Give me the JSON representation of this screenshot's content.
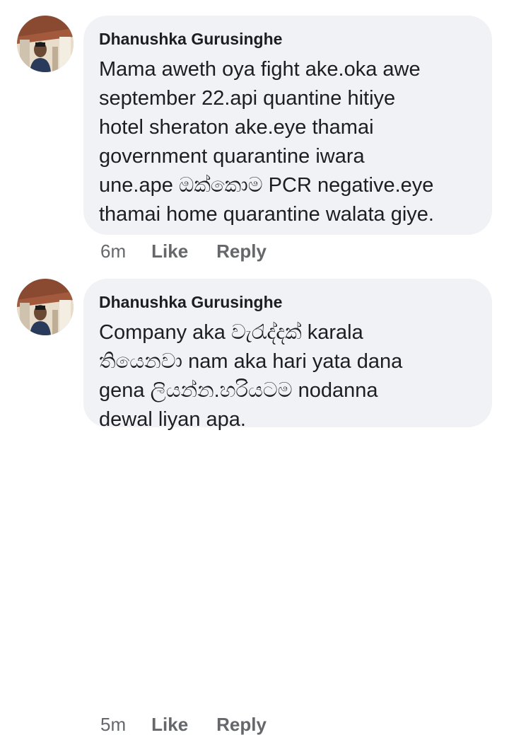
{
  "comments": [
    {
      "author": "Dhanushka Gurusinghe",
      "text": "Mama aweth oya fight ake.oka awe\nseptember 22.api quantine hitiye\nhotel sheraton ake.eye thamai\ngovernment quarantine iwara\nune.ape ඔක්කොම PCR negative.eye\nthamai home quarantine walata giye.",
      "time": "6m",
      "like_label": "Like",
      "reply_label": "Reply"
    },
    {
      "author": "Dhanushka Gurusinghe",
      "text": "Company aka වැරැද්දක් karala\nතියෙනවා nam aka hari yata dana\ngena ලියන්න.හරියටම nodanna\ndewal liyan apa.",
      "time": "5m",
      "like_label": "Like",
      "reply_label": "Reply"
    }
  ],
  "colors": {
    "bubble_bg": "#f0f2f5",
    "text": "#1c1e21",
    "meta": "#65676b"
  },
  "icons": {
    "avatar": "profile-photo"
  }
}
